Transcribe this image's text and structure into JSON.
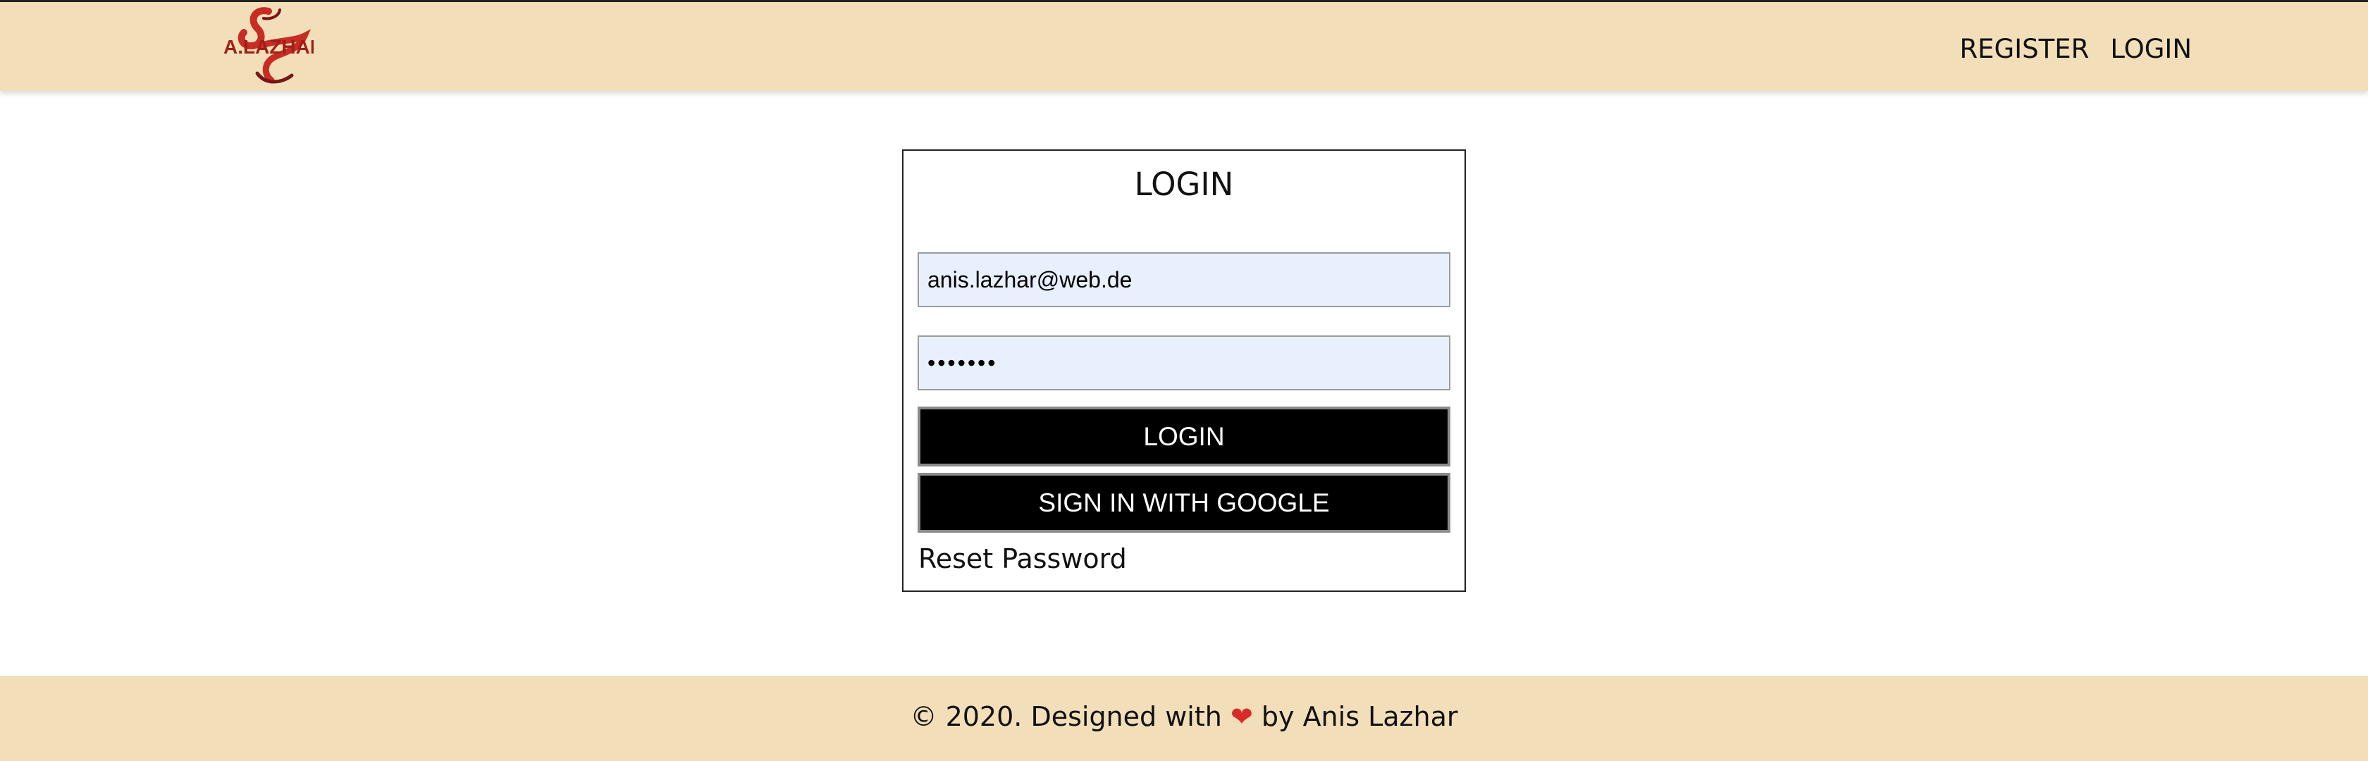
{
  "brand": {
    "logo_text": "A.LAZHAR",
    "colors": {
      "header_bg": "#f2dfb9",
      "logo_red": "#c82d24",
      "logo_dark_red": "#7a1515",
      "button_bg": "#000000",
      "input_bg": "#e8f0fe",
      "heart": "#d92b2b"
    }
  },
  "header": {
    "nav": {
      "register_label": "REGISTER",
      "login_label": "LOGIN"
    }
  },
  "login_form": {
    "title": "LOGIN",
    "email_value": "anis.lazhar@web.de",
    "password_value": "•••••••",
    "login_button_label": "LOGIN",
    "google_button_label": "SIGN IN WITH GOOGLE",
    "reset_password_label": "Reset Password"
  },
  "footer": {
    "text_before_icon": "© 2020. Designed with",
    "icon": "heart-icon",
    "text_after_icon": "by Anis Lazhar"
  }
}
